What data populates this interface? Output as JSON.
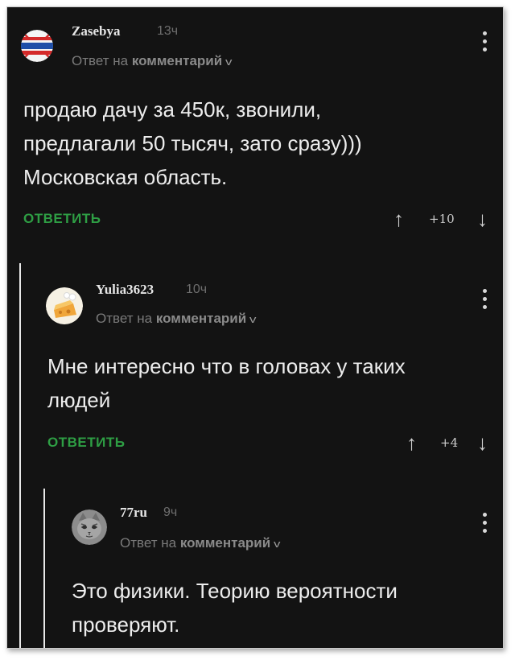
{
  "comments": [
    {
      "username": "Zasebya",
      "time": "13ч",
      "reply_prefix": "Ответ на",
      "reply_link": "комментарий",
      "text_lines": [
        "продаю дачу за 450к, звонили,",
        "предлагали 50 тысяч, зато сразу)))",
        "Московская область."
      ],
      "reply_label": "ОТВЕТИТЬ",
      "score": "+10",
      "avatar": "flag-avatar"
    },
    {
      "username": "Yulia3623",
      "time": "10ч",
      "reply_prefix": "Ответ на",
      "reply_link": "комментарий",
      "text_lines": [
        "Мне интересно что в головах у таких",
        "людей"
      ],
      "reply_label": "ОТВЕТИТЬ",
      "score": "+4",
      "avatar": "cheese-avatar"
    },
    {
      "username": "77ru",
      "time": "9ч",
      "reply_prefix": "Ответ на",
      "reply_link": "комментарий",
      "text_lines": [
        "Это физики. Теорию вероятности",
        "проверяют."
      ],
      "avatar": "cat-avatar"
    }
  ],
  "icons": {
    "upvote": "↑",
    "downvote": "↓",
    "chevron": "v",
    "menu": "more-vertical-icon"
  },
  "colors": {
    "background": "#131313",
    "accent_green": "#2e9e44",
    "muted_text": "#7a7a7a"
  }
}
